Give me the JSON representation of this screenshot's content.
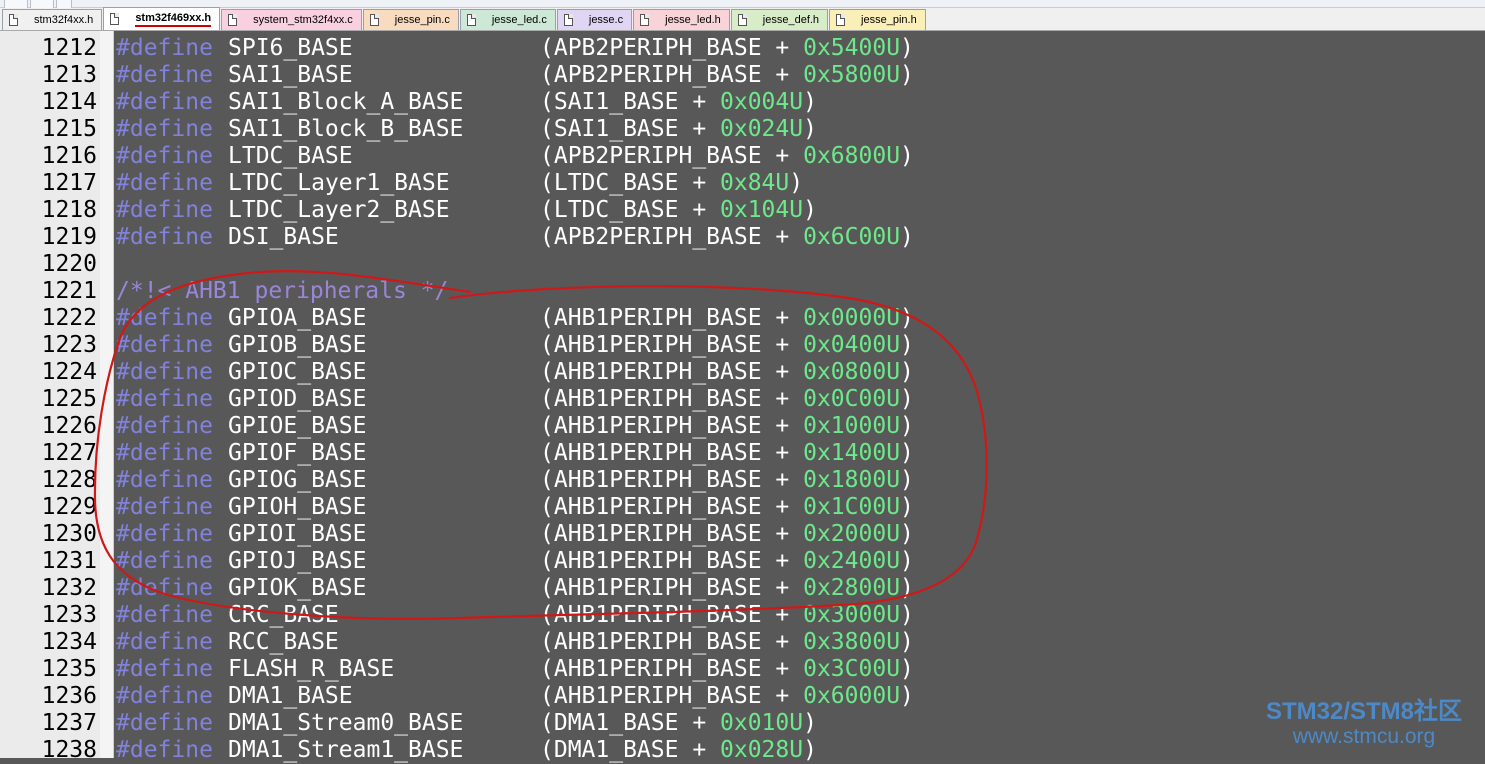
{
  "tabs": [
    {
      "label": "stm32f4xx.h",
      "color": "#f0f0f0",
      "active": false
    },
    {
      "label": "stm32f469xx.h",
      "color": "#ffffff",
      "active": true
    },
    {
      "label": "system_stm32f4xx.c",
      "color": "#f8d0df",
      "active": false
    },
    {
      "label": "jesse_pin.c",
      "color": "#f9dcc0",
      "active": false
    },
    {
      "label": "jesse_led.c",
      "color": "#cde8d6",
      "active": false
    },
    {
      "label": "jesse.c",
      "color": "#e0d6f4",
      "active": false
    },
    {
      "label": "jesse_led.h",
      "color": "#f8d4d8",
      "active": false
    },
    {
      "label": "jesse_def.h",
      "color": "#d8ecc8",
      "active": false
    },
    {
      "label": "jesse_pin.h",
      "color": "#fbefb8",
      "active": false
    }
  ],
  "code_lines": [
    {
      "num": "1212",
      "kw": "#define",
      "name": "SPI6_BASE",
      "open": "(APB2PERIPH_BASE + ",
      "hex": "0x5400U",
      "close": ")"
    },
    {
      "num": "1213",
      "kw": "#define",
      "name": "SAI1_BASE",
      "open": "(APB2PERIPH_BASE + ",
      "hex": "0x5800U",
      "close": ")"
    },
    {
      "num": "1214",
      "kw": "#define",
      "name": "SAI1_Block_A_BASE",
      "open": "(SAI1_BASE + ",
      "hex": "0x004U",
      "close": ")"
    },
    {
      "num": "1215",
      "kw": "#define",
      "name": "SAI1_Block_B_BASE",
      "open": "(SAI1_BASE + ",
      "hex": "0x024U",
      "close": ")"
    },
    {
      "num": "1216",
      "kw": "#define",
      "name": "LTDC_BASE",
      "open": "(APB2PERIPH_BASE + ",
      "hex": "0x6800U",
      "close": ")"
    },
    {
      "num": "1217",
      "kw": "#define",
      "name": "LTDC_Layer1_BASE",
      "open": "(LTDC_BASE + ",
      "hex": "0x84U",
      "close": ")"
    },
    {
      "num": "1218",
      "kw": "#define",
      "name": "LTDC_Layer2_BASE",
      "open": "(LTDC_BASE + ",
      "hex": "0x104U",
      "close": ")"
    },
    {
      "num": "1219",
      "kw": "#define",
      "name": "DSI_BASE",
      "open": "(APB2PERIPH_BASE + ",
      "hex": "0x6C00U",
      "close": ")"
    },
    {
      "num": "1220",
      "kw": "",
      "name": "",
      "open": "",
      "hex": "",
      "close": ""
    },
    {
      "num": "1221",
      "comment": "/*!< AHB1 peripherals */"
    },
    {
      "num": "1222",
      "kw": "#define",
      "name": "GPIOA_BASE",
      "open": "(AHB1PERIPH_BASE + ",
      "hex": "0x0000U",
      "close": ")"
    },
    {
      "num": "1223",
      "kw": "#define",
      "name": "GPIOB_BASE",
      "open": "(AHB1PERIPH_BASE + ",
      "hex": "0x0400U",
      "close": ")"
    },
    {
      "num": "1224",
      "kw": "#define",
      "name": "GPIOC_BASE",
      "open": "(AHB1PERIPH_BASE + ",
      "hex": "0x0800U",
      "close": ")"
    },
    {
      "num": "1225",
      "kw": "#define",
      "name": "GPIOD_BASE",
      "open": "(AHB1PERIPH_BASE + ",
      "hex": "0x0C00U",
      "close": ")"
    },
    {
      "num": "1226",
      "kw": "#define",
      "name": "GPIOE_BASE",
      "open": "(AHB1PERIPH_BASE + ",
      "hex": "0x1000U",
      "close": ")"
    },
    {
      "num": "1227",
      "kw": "#define",
      "name": "GPIOF_BASE",
      "open": "(AHB1PERIPH_BASE + ",
      "hex": "0x1400U",
      "close": ")"
    },
    {
      "num": "1228",
      "kw": "#define",
      "name": "GPIOG_BASE",
      "open": "(AHB1PERIPH_BASE + ",
      "hex": "0x1800U",
      "close": ")"
    },
    {
      "num": "1229",
      "kw": "#define",
      "name": "GPIOH_BASE",
      "open": "(AHB1PERIPH_BASE + ",
      "hex": "0x1C00U",
      "close": ")"
    },
    {
      "num": "1230",
      "kw": "#define",
      "name": "GPIOI_BASE",
      "open": "(AHB1PERIPH_BASE + ",
      "hex": "0x2000U",
      "close": ")"
    },
    {
      "num": "1231",
      "kw": "#define",
      "name": "GPIOJ_BASE",
      "open": "(AHB1PERIPH_BASE + ",
      "hex": "0x2400U",
      "close": ")"
    },
    {
      "num": "1232",
      "kw": "#define",
      "name": "GPIOK_BASE",
      "open": "(AHB1PERIPH_BASE + ",
      "hex": "0x2800U",
      "close": ")"
    },
    {
      "num": "1233",
      "kw": "#define",
      "name": "CRC_BASE",
      "open": "(AHB1PERIPH_BASE + ",
      "hex": "0x3000U",
      "close": ")"
    },
    {
      "num": "1234",
      "kw": "#define",
      "name": "RCC_BASE",
      "open": "(AHB1PERIPH_BASE + ",
      "hex": "0x3800U",
      "close": ")"
    },
    {
      "num": "1235",
      "kw": "#define",
      "name": "FLASH_R_BASE",
      "open": "(AHB1PERIPH_BASE + ",
      "hex": "0x3C00U",
      "close": ")"
    },
    {
      "num": "1236",
      "kw": "#define",
      "name": "DMA1_BASE",
      "open": "(AHB1PERIPH_BASE + ",
      "hex": "0x6000U",
      "close": ")"
    },
    {
      "num": "1237",
      "kw": "#define",
      "name": "DMA1_Stream0_BASE",
      "open": "(DMA1_BASE + ",
      "hex": "0x010U",
      "close": ")"
    },
    {
      "num": "1238",
      "kw": "#define",
      "name": "DMA1_Stream1_BASE",
      "open": "(DMA1_BASE + ",
      "hex": "0x028U",
      "close": ")"
    }
  ],
  "watermark": {
    "line1": "STM32/STM8社区",
    "line2": "www.stmcu.org"
  },
  "colors": {
    "editor_bg": "#585858",
    "keyword": "#8282dd",
    "identifier": "#ffffff",
    "hex_literal": "#6de88a",
    "comment": "#9a86d8",
    "annotation": "#d01818",
    "watermark": "#4d89c6"
  }
}
